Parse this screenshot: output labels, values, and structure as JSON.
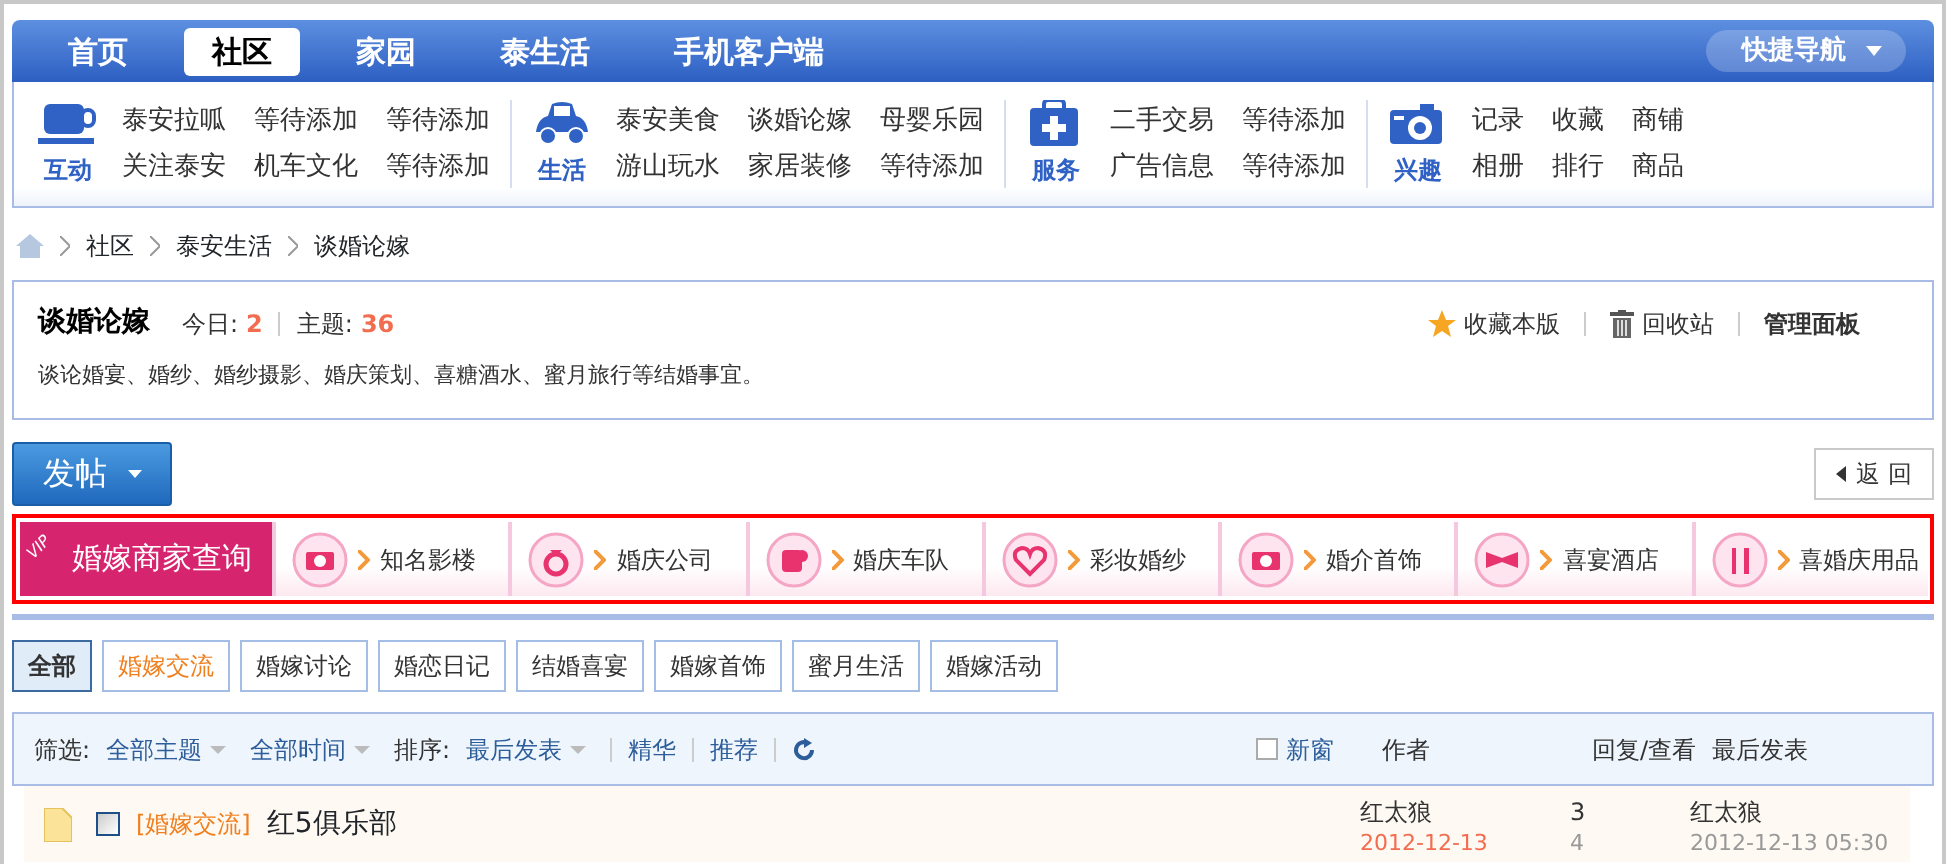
{
  "nav": {
    "tabs": [
      {
        "label": "首页",
        "selected": false
      },
      {
        "label": "社区",
        "selected": true
      },
      {
        "label": "家园",
        "selected": false
      },
      {
        "label": "泰生活",
        "selected": false
      },
      {
        "label": "手机客户端",
        "selected": false
      }
    ],
    "quick_nav": "快捷导航"
  },
  "subnav": [
    {
      "label": "互动",
      "links": [
        "泰安拉呱",
        "等待添加",
        "等待添加",
        "关注泰安",
        "机车文化",
        "等待添加"
      ]
    },
    {
      "label": "生活",
      "links": [
        "泰安美食",
        "谈婚论嫁",
        "母婴乐园",
        "游山玩水",
        "家居装修",
        "等待添加"
      ]
    },
    {
      "label": "服务",
      "links": [
        "二手交易",
        "等待添加",
        "广告信息",
        "等待添加"
      ]
    },
    {
      "label": "兴趣",
      "links": [
        "记录",
        "收藏",
        "商铺",
        "相册",
        "排行",
        "商品"
      ]
    }
  ],
  "breadcrumb": [
    "社区",
    "泰安生活",
    "谈婚论嫁"
  ],
  "forum": {
    "title": "谈婚论嫁",
    "today_label": "今日:",
    "today": "2",
    "topics_label": "主题:",
    "topics": "36",
    "actions": [
      "收藏本版",
      "回收站",
      "管理面板"
    ],
    "description": "谈论婚宴、婚纱、婚纱摄影、婚庆策划、喜糖酒水、蜜月旅行等结婚事宜。"
  },
  "post_button": "发帖",
  "back_button": "返 回",
  "vendors": {
    "vip": "VIP",
    "title": "婚嫁商家查询",
    "items": [
      "知名影楼",
      "婚庆公司",
      "婚庆车队",
      "彩妆婚纱",
      "婚介首饰",
      "喜宴酒店",
      "喜婚庆用品"
    ]
  },
  "categories": [
    {
      "label": "全部",
      "selected": true,
      "color": "#333333"
    },
    {
      "label": "婚嫁交流",
      "selected": false,
      "color": "#f07f1e"
    },
    {
      "label": "婚嫁讨论",
      "selected": false,
      "color": "#333333"
    },
    {
      "label": "婚恋日记",
      "selected": false,
      "color": "#333333"
    },
    {
      "label": "结婚喜宴",
      "selected": false,
      "color": "#333333"
    },
    {
      "label": "婚嫁首饰",
      "selected": false,
      "color": "#333333"
    },
    {
      "label": "蜜月生活",
      "selected": false,
      "color": "#333333"
    },
    {
      "label": "婚嫁活动",
      "selected": false,
      "color": "#333333"
    }
  ],
  "filter": {
    "label": "筛选:",
    "options": [
      "全部主题",
      "全部时间"
    ],
    "sort_label": "排序:",
    "sort": "最后发表",
    "links": [
      "精华",
      "推荐"
    ],
    "new_window": {
      "label": "新窗",
      "checked": false
    },
    "columns": [
      "作者",
      "回复/查看",
      "最后发表"
    ]
  },
  "threads": [
    {
      "category": "[婚嫁交流]",
      "title": "红5俱乐部",
      "checked": false,
      "author": "红太狼",
      "author_date": "2012-12-13",
      "replies": "3",
      "views": "4",
      "last_author": "红太狼",
      "last_date": "2012-12-13 05:30"
    }
  ]
}
